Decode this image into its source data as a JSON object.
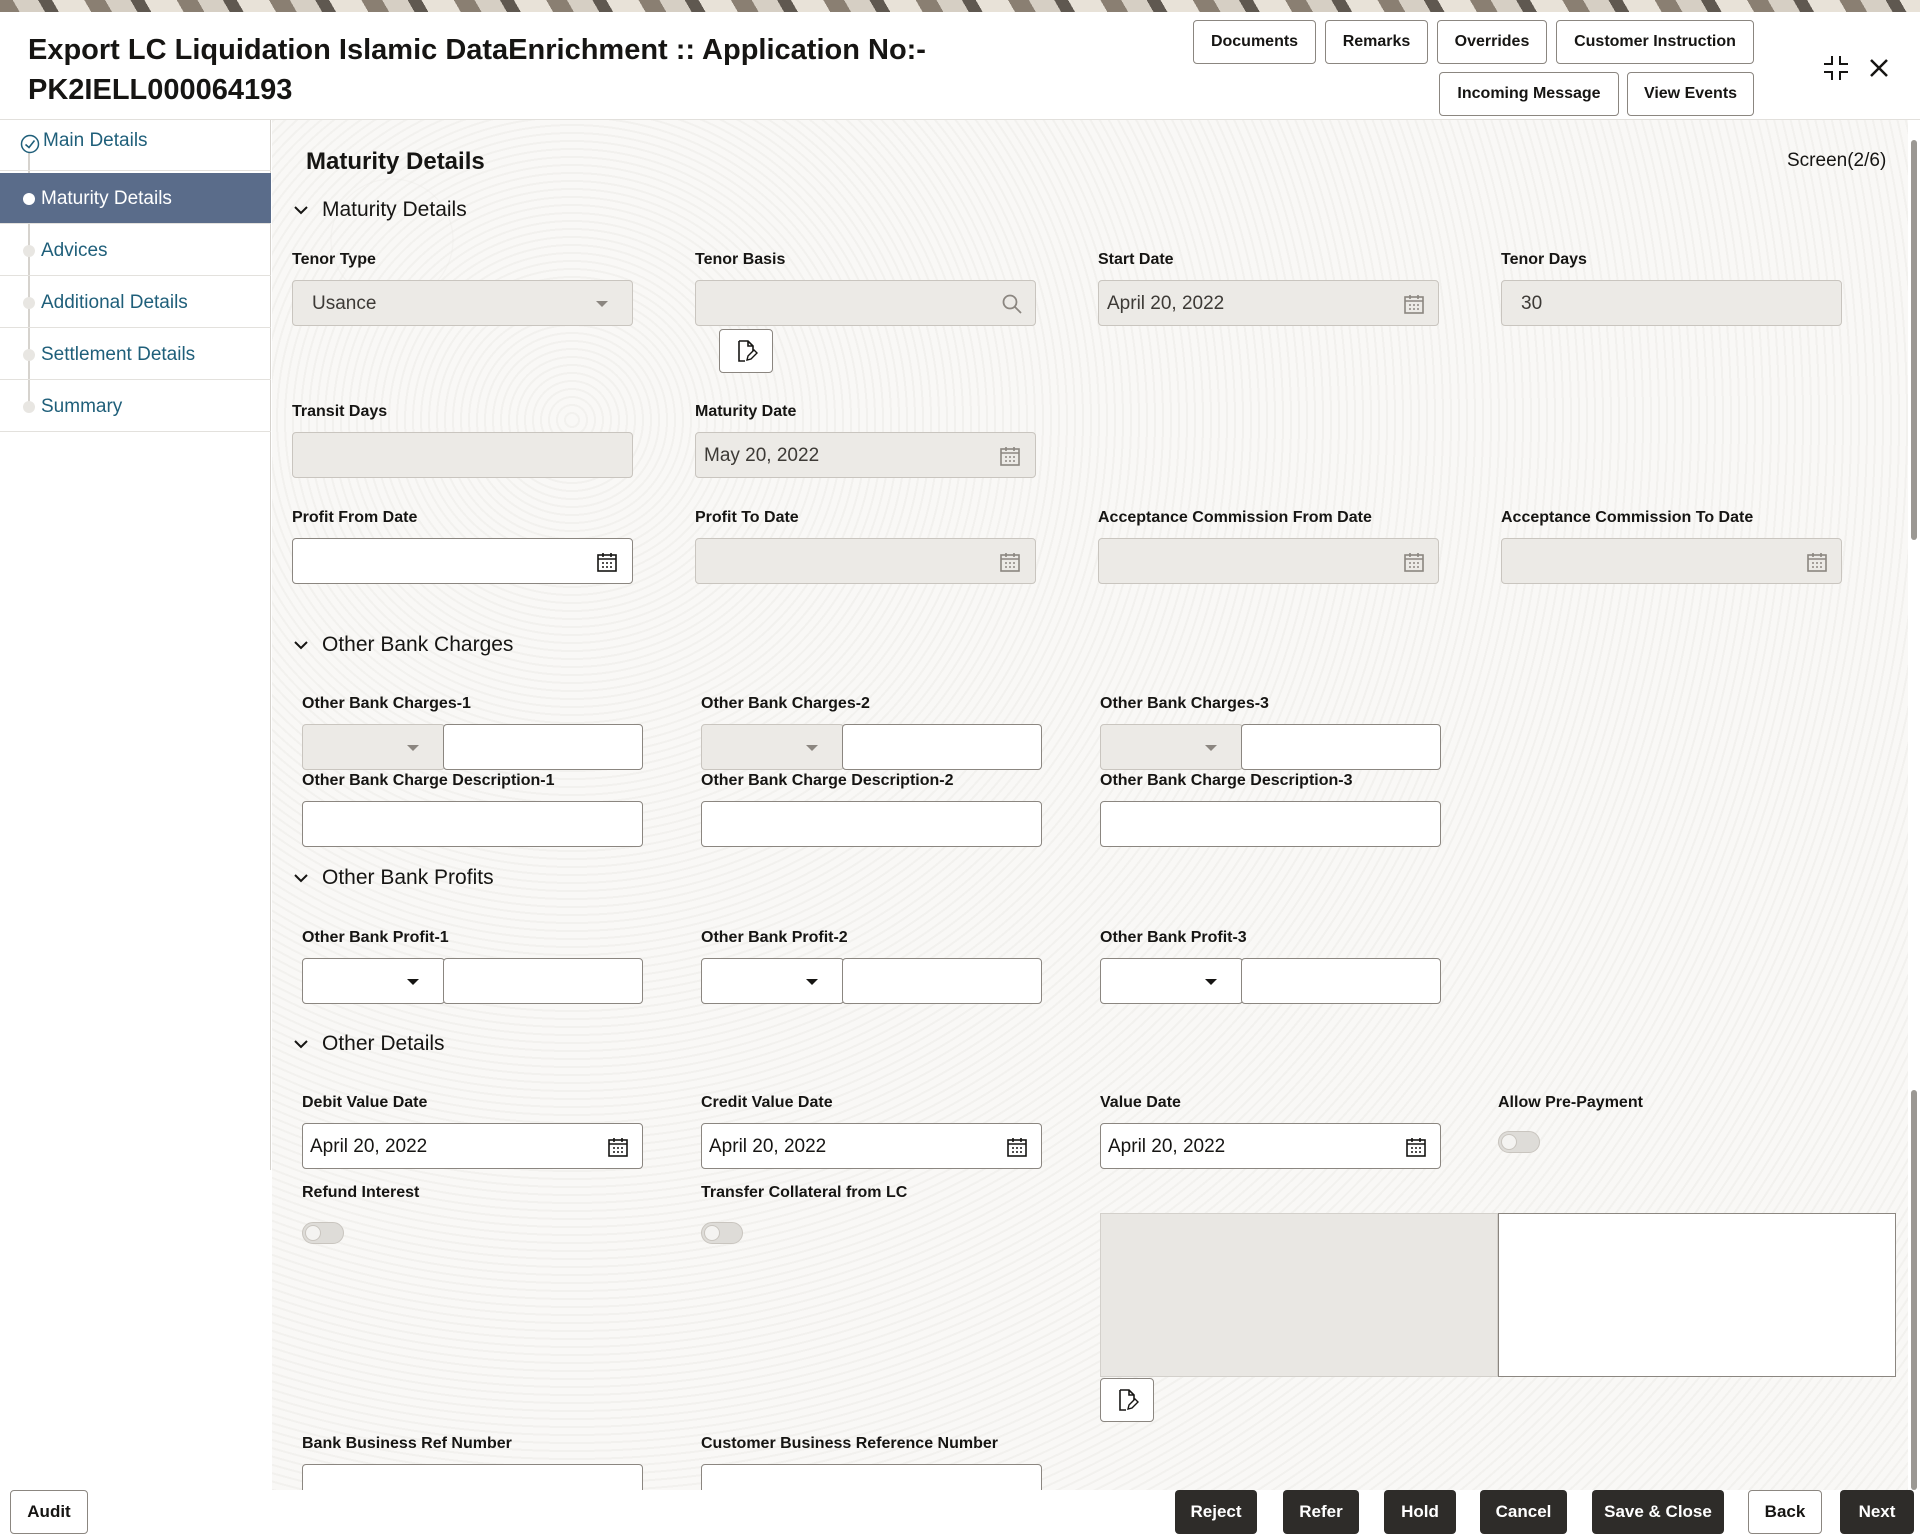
{
  "header": {
    "title": "Export LC Liquidation Islamic DataEnrichment :: Application No:- PK2IELL000064193",
    "buttons": {
      "documents": "Documents",
      "remarks": "Remarks",
      "overrides": "Overrides",
      "customer_instruction": "Customer Instruction",
      "incoming_message": "Incoming Message",
      "view_events": "View Events"
    }
  },
  "sidebar": {
    "items": [
      {
        "label": "Main Details",
        "state": "completed"
      },
      {
        "label": "Maturity Details",
        "state": "active"
      },
      {
        "label": "Advices",
        "state": "pending"
      },
      {
        "label": "Additional Details",
        "state": "pending"
      },
      {
        "label": "Settlement Details",
        "state": "pending"
      },
      {
        "label": "Summary",
        "state": "pending"
      }
    ]
  },
  "main": {
    "page_title": "Maturity Details",
    "screen_indicator": "Screen(2/6)",
    "maturity": {
      "section_title": "Maturity Details",
      "tenor_type": {
        "label": "Tenor Type",
        "value": "Usance"
      },
      "tenor_basis": {
        "label": "Tenor Basis",
        "value": ""
      },
      "start_date": {
        "label": "Start Date",
        "value": "April 20, 2022"
      },
      "tenor_days": {
        "label": "Tenor Days",
        "value": "30"
      },
      "transit_days": {
        "label": "Transit Days",
        "value": ""
      },
      "maturity_date": {
        "label": "Maturity Date",
        "value": "May 20, 2022"
      },
      "profit_from_date": {
        "label": "Profit From Date",
        "value": ""
      },
      "profit_to_date": {
        "label": "Profit To Date",
        "value": ""
      },
      "acceptance_from": {
        "label": "Acceptance Commission From Date",
        "value": ""
      },
      "acceptance_to": {
        "label": "Acceptance Commission To Date",
        "value": ""
      }
    },
    "other_bank_charges": {
      "section_title": "Other Bank Charges",
      "charges": [
        {
          "label": "Other Bank Charges-1",
          "desc_label": "Other Bank Charge Description-1"
        },
        {
          "label": "Other Bank Charges-2",
          "desc_label": "Other Bank Charge Description-2"
        },
        {
          "label": "Other Bank Charges-3",
          "desc_label": "Other Bank Charge Description-3"
        }
      ]
    },
    "other_bank_profits": {
      "section_title": "Other Bank Profits",
      "profits": [
        {
          "label": "Other Bank Profit-1"
        },
        {
          "label": "Other Bank Profit-2"
        },
        {
          "label": "Other Bank Profit-3"
        }
      ]
    },
    "other_details": {
      "section_title": "Other Details",
      "debit_value_date": {
        "label": "Debit Value Date",
        "value": "April 20, 2022"
      },
      "credit_value_date": {
        "label": "Credit Value Date",
        "value": "April 20, 2022"
      },
      "value_date": {
        "label": "Value Date",
        "value": "April 20, 2022"
      },
      "allow_prepayment": {
        "label": "Allow Pre-Payment",
        "checked": false
      },
      "refund_interest": {
        "label": "Refund Interest",
        "checked": false
      },
      "transfer_collateral": {
        "label": "Transfer Collateral from LC",
        "checked": false
      },
      "bank_business_ref": {
        "label": "Bank Business Ref Number",
        "value": ""
      },
      "customer_business_ref": {
        "label": "Customer Business Reference Number",
        "value": ""
      }
    }
  },
  "footer": {
    "audit": "Audit",
    "reject": "Reject",
    "refer": "Refer",
    "hold": "Hold",
    "cancel": "Cancel",
    "save_close": "Save & Close",
    "back": "Back",
    "next": "Next"
  },
  "colors": {
    "active_nav": "#5a6c8a",
    "link_text": "#1f5f7a",
    "primary_button": "#2e2c29"
  }
}
